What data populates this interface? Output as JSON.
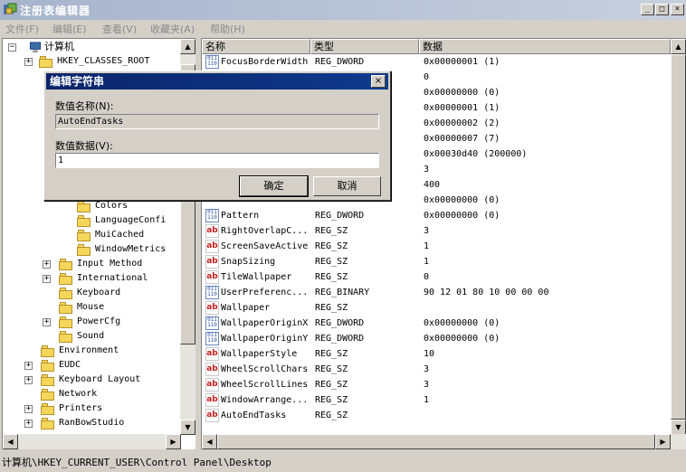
{
  "window": {
    "title": "注册表编辑器",
    "min": "_",
    "max": "□",
    "close": "×"
  },
  "menu": [
    "文件(F)",
    "编辑(E)",
    "查看(V)",
    "收藏夹(A)",
    "帮助(H)"
  ],
  "tree": {
    "root": "计算机",
    "hkcr": "HKEY_CLASSES_ROOT",
    "items": [
      {
        "label": "Colors",
        "indent": 2,
        "expander": ""
      },
      {
        "label": "LanguageConfi",
        "indent": 2,
        "expander": ""
      },
      {
        "label": "MuiCached",
        "indent": 2,
        "expander": ""
      },
      {
        "label": "WindowMetrics",
        "indent": 2,
        "expander": ""
      },
      {
        "label": "Input Method",
        "indent": 1,
        "expander": "+"
      },
      {
        "label": "International",
        "indent": 1,
        "expander": "+"
      },
      {
        "label": "Keyboard",
        "indent": 1,
        "expander": ""
      },
      {
        "label": "Mouse",
        "indent": 1,
        "expander": ""
      },
      {
        "label": "PowerCfg",
        "indent": 1,
        "expander": "+"
      },
      {
        "label": "Sound",
        "indent": 1,
        "expander": ""
      },
      {
        "label": "Environment",
        "indent": 0,
        "expander": ""
      },
      {
        "label": "EUDC",
        "indent": 0,
        "expander": "+"
      },
      {
        "label": "Keyboard Layout",
        "indent": 0,
        "expander": "+"
      },
      {
        "label": "Network",
        "indent": 0,
        "expander": ""
      },
      {
        "label": "Printers",
        "indent": 0,
        "expander": "+"
      },
      {
        "label": "RanBowStudio",
        "indent": 0,
        "expander": "+"
      }
    ]
  },
  "list": {
    "columns": {
      "name": "名称",
      "type": "类型",
      "data": "数据"
    },
    "rows": [
      {
        "name": "FocusBorderWidth",
        "type": "REG_DWORD",
        "data": "0x00000001 (1)",
        "icon": "binary"
      },
      {
        "name": "",
        "type": "",
        "data": "0",
        "icon": ""
      },
      {
        "name": "",
        "type": "",
        "data": "0x00000000 (0)",
        "icon": ""
      },
      {
        "name": "",
        "type": "",
        "data": "0x00000001 (1)",
        "icon": ""
      },
      {
        "name": "",
        "type": "",
        "data": "0x00000002 (2)",
        "icon": ""
      },
      {
        "name": "",
        "type": "",
        "data": "0x00000007 (7)",
        "icon": ""
      },
      {
        "name": "",
        "type": "",
        "data": "0x00030d40 (200000)",
        "icon": ""
      },
      {
        "name": "",
        "type": "",
        "data": "3",
        "icon": ""
      },
      {
        "name": "",
        "type": "",
        "data": "400",
        "icon": ""
      },
      {
        "name": "",
        "type": "",
        "data": "0x00000000 (0)",
        "icon": ""
      },
      {
        "name": "Pattern",
        "type": "REG_DWORD",
        "data": "0x00000000 (0)",
        "icon": "binary"
      },
      {
        "name": "RightOverlapC...",
        "type": "REG_SZ",
        "data": "3",
        "icon": "string"
      },
      {
        "name": "ScreenSaveActive",
        "type": "REG_SZ",
        "data": "1",
        "icon": "string"
      },
      {
        "name": "SnapSizing",
        "type": "REG_SZ",
        "data": "1",
        "icon": "string"
      },
      {
        "name": "TileWallpaper",
        "type": "REG_SZ",
        "data": "0",
        "icon": "string"
      },
      {
        "name": "UserPreferenc...",
        "type": "REG_BINARY",
        "data": "90 12 01 80 10 00 00 00",
        "icon": "binary"
      },
      {
        "name": "Wallpaper",
        "type": "REG_SZ",
        "data": "",
        "icon": "string"
      },
      {
        "name": "WallpaperOriginX",
        "type": "REG_DWORD",
        "data": "0x00000000 (0)",
        "icon": "binary"
      },
      {
        "name": "WallpaperOriginY",
        "type": "REG_DWORD",
        "data": "0x00000000 (0)",
        "icon": "binary"
      },
      {
        "name": "WallpaperStyle",
        "type": "REG_SZ",
        "data": "10",
        "icon": "string"
      },
      {
        "name": "WheelScrollChars",
        "type": "REG_SZ",
        "data": "3",
        "icon": "string"
      },
      {
        "name": "WheelScrollLines",
        "type": "REG_SZ",
        "data": "3",
        "icon": "string"
      },
      {
        "name": "WindowArrange...",
        "type": "REG_SZ",
        "data": "1",
        "icon": "string"
      },
      {
        "name": "AutoEndTasks",
        "type": "REG_SZ",
        "data": "",
        "icon": "string"
      }
    ]
  },
  "status": "计算机\\HKEY_CURRENT_USER\\Control Panel\\Desktop",
  "dialog": {
    "title": "编辑字符串",
    "close": "×",
    "name_label": "数值名称(N):",
    "name_value": "AutoEndTasks",
    "data_label": "数值数据(V):",
    "data_value": "1",
    "ok": "确定",
    "cancel": "取消"
  },
  "colors": {
    "titlebar": "#a6b4cc",
    "dialog_title": "#0a246a",
    "face": "#d4d0c8"
  }
}
